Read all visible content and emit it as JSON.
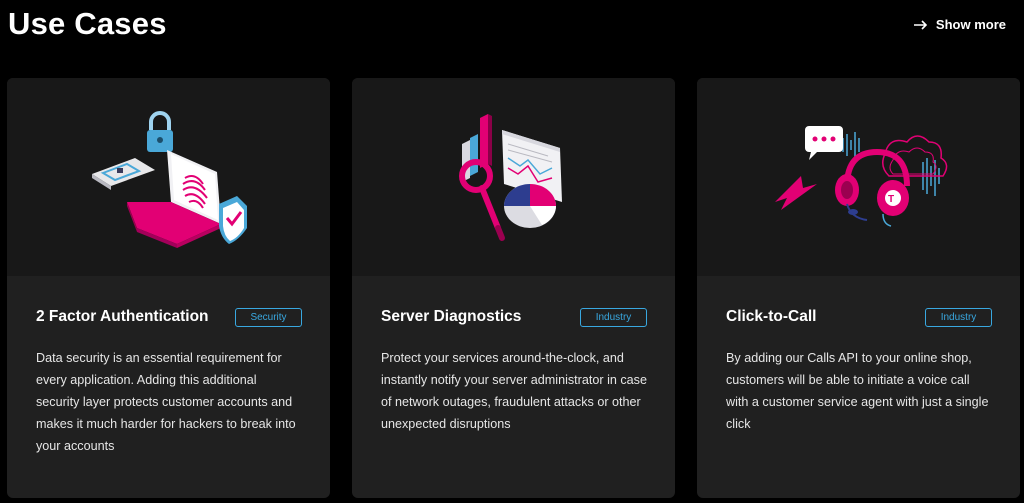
{
  "header": {
    "title": "Use Cases",
    "show_more_label": "Show more"
  },
  "colors": {
    "background": "#000000",
    "card": "#202020",
    "accent_magenta": "#e20074",
    "tag_blue": "#39a8e0"
  },
  "cards": [
    {
      "title": "2 Factor Authentication",
      "tag": "Security",
      "description": "Data security is an essential requirement for every application. Adding this additional security layer protects customer accounts and makes it much harder for hackers to break into your accounts",
      "illustration": "laptop-fingerprint-lock-shield-icon"
    },
    {
      "title": "Server Diagnostics",
      "tag": "Industry",
      "description": "Protect your services around-the-clock, and instantly notify your server administrator in case of network outages, fraudulent attacks or other unexpected disruptions",
      "illustration": "magnifier-chart-diagnostics-icon"
    },
    {
      "title": "Click-to-Call",
      "tag": "Industry",
      "description": "By adding our Calls API to your online shop, customers will be able to initiate a voice call with a customer service agent with just a single click",
      "illustration": "headset-chat-cursor-icon"
    }
  ]
}
